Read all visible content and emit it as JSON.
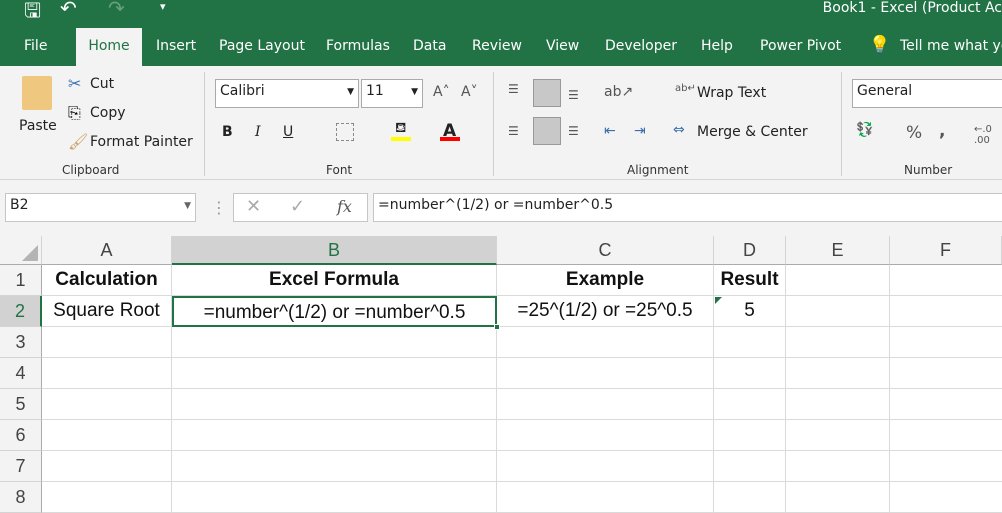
{
  "window": {
    "title": "Book1  -  Excel (Product Ac"
  },
  "qat": {
    "save": "save-icon",
    "undo": "undo-icon",
    "redo": "redo-icon"
  },
  "tabs": [
    "File",
    "Home",
    "Insert",
    "Page Layout",
    "Formulas",
    "Data",
    "Review",
    "View",
    "Developer",
    "Help",
    "Power Pivot"
  ],
  "tell_me": "Tell me what yo",
  "clipboard": {
    "paste": "Paste",
    "cut": "Cut",
    "copy": "Copy",
    "format_painter": "Format Painter",
    "group": "Clipboard"
  },
  "font": {
    "name": "Calibri",
    "size": "11",
    "bold": "B",
    "italic": "I",
    "underline": "U",
    "color_letter": "A",
    "group": "Font",
    "highlight_color": "#ffff00",
    "font_color": "#ff0000"
  },
  "alignment": {
    "wrap": "Wrap Text",
    "merge": "Merge & Center",
    "group": "Alignment"
  },
  "number": {
    "format": "General",
    "percent": "%",
    "comma": ",",
    "group": "Number"
  },
  "formula_bar": {
    "name_box": "B2",
    "fx": "fx",
    "formula": "=number^(1/2) or =number^0.5"
  },
  "columns": [
    "A",
    "B",
    "C",
    "D",
    "E",
    "F"
  ],
  "rows": [
    "1",
    "2",
    "3",
    "4",
    "5",
    "6",
    "7",
    "8"
  ],
  "cells": {
    "A1": "Calculation",
    "B1": "Excel Formula",
    "C1": "Example",
    "D1": "Result",
    "A2": "Square Root",
    "B2": "=number^(1/2) or =number^0.5",
    "C2": "=25^(1/2) or =25^0.5",
    "D2": "5"
  },
  "colors": {
    "accent": "#217346"
  }
}
